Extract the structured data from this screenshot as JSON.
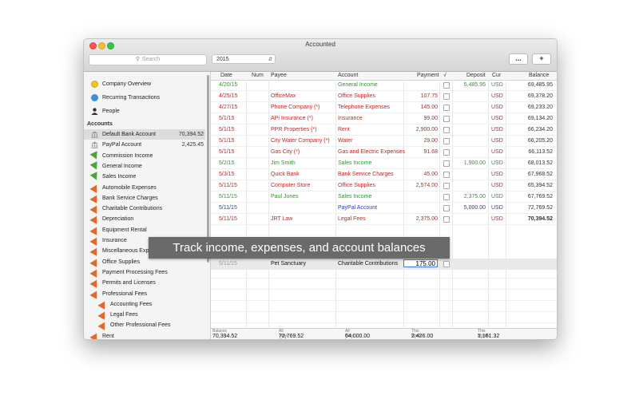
{
  "window": {
    "title": "Accounted"
  },
  "toolbar": {
    "search_placeholder": "Search",
    "year": "2015",
    "more_label": "...",
    "add_label": "+"
  },
  "sidebar": {
    "top_items": [
      {
        "label": "Company Overview",
        "icon": "company-overview-icon"
      },
      {
        "label": "Recurring Transactions",
        "icon": "recurring-icon"
      },
      {
        "label": "People",
        "icon": "person-icon"
      }
    ],
    "accounts_heading": "Accounts",
    "accounts": [
      {
        "label": "Default Bank Account",
        "amount": "70,394.52",
        "icon": "bank-icon"
      },
      {
        "label": "PayPal Account",
        "amount": "2,425.45",
        "icon": "bank-icon"
      },
      {
        "label": "Commission Income",
        "icon": "income-icon"
      },
      {
        "label": "General Income",
        "icon": "income-icon"
      },
      {
        "label": "Sales Income",
        "icon": "income-icon"
      },
      {
        "label": "Automobile Expenses",
        "icon": "expense-icon"
      },
      {
        "label": "Bank Service Charges",
        "icon": "expense-icon"
      },
      {
        "label": "Charitable Contributions",
        "icon": "expense-icon"
      },
      {
        "label": "Depreciation",
        "icon": "expense-icon"
      },
      {
        "label": "Equipment Rental",
        "icon": "expense-icon"
      },
      {
        "label": "Insurance",
        "icon": "expense-icon"
      },
      {
        "label": "Miscellaneous Expenses",
        "icon": "expense-icon"
      },
      {
        "label": "Office Supplies",
        "icon": "expense-icon"
      },
      {
        "label": "Payment Processing Fees",
        "icon": "expense-icon"
      },
      {
        "label": "Permits and Licenses",
        "icon": "expense-icon"
      },
      {
        "label": "Professional Fees",
        "icon": "expense-icon"
      },
      {
        "label": "Accounting Fees",
        "icon": "expense-icon"
      },
      {
        "label": "Legal Fees",
        "icon": "expense-icon"
      },
      {
        "label": "Other Professional Fees",
        "icon": "expense-icon"
      },
      {
        "label": "Rent",
        "icon": "expense-icon"
      }
    ]
  },
  "table": {
    "headers": [
      "Date",
      "Num",
      "Payee",
      "Account",
      "Payment",
      "√",
      "Deposit",
      "Cur",
      "Balance"
    ],
    "rows": [
      {
        "date": "4/20/15",
        "num": "",
        "payee": "",
        "account": "General Income",
        "payment": "",
        "deposit": "5,485.95",
        "cur": "USD",
        "balance": "69,485.95",
        "color": "#2a9a2a"
      },
      {
        "date": "4/25/15",
        "num": "",
        "payee": "OfficeMax",
        "account": "Office Supplies",
        "payment": "107.75",
        "deposit": "",
        "cur": "USD",
        "balance": "69,378.20",
        "color": "#cc2020"
      },
      {
        "date": "4/27/15",
        "num": "",
        "payee": "Phone Company (*)",
        "account": "Telephone Expenses",
        "payment": "145.00",
        "deposit": "",
        "cur": "USD",
        "balance": "69,233.20",
        "color": "#cc2020"
      },
      {
        "date": "5/1/15",
        "num": "",
        "payee": "APi Insurance (*)",
        "account": "Insurance",
        "payment": "99.00",
        "deposit": "",
        "cur": "USD",
        "balance": "69,134.20",
        "color": "#cc2020"
      },
      {
        "date": "5/1/15",
        "num": "",
        "payee": "PPR Properties (*)",
        "account": "Rent",
        "payment": "2,900.00",
        "deposit": "",
        "cur": "USD",
        "balance": "66,234.20",
        "color": "#cc2020"
      },
      {
        "date": "5/1/15",
        "num": "",
        "payee": "City Water Company (*)",
        "account": "Water",
        "payment": "29.00",
        "deposit": "",
        "cur": "USD",
        "balance": "66,205.20",
        "color": "#cc2020"
      },
      {
        "date": "5/1/15",
        "num": "",
        "payee": "Gas City (*)",
        "account": "Gas and Electric Expenses",
        "payment": "91.68",
        "deposit": "",
        "cur": "USD",
        "balance": "66,113.52",
        "color": "#cc2020"
      },
      {
        "date": "5/2/15",
        "num": "",
        "payee": "Jim Smith",
        "account": "Sales Income",
        "payment": "",
        "deposit": "1,900.00",
        "cur": "USD",
        "balance": "68,013.52",
        "color": "#2a9a2a"
      },
      {
        "date": "5/3/15",
        "num": "",
        "payee": "Quick Bank",
        "account": "Bank Service Charges",
        "payment": "45.00",
        "deposit": "",
        "cur": "USD",
        "balance": "67,968.52",
        "color": "#cc2020"
      },
      {
        "date": "5/11/15",
        "num": "",
        "payee": "Computer Store",
        "account": "Office Supplies",
        "payment": "2,574.00",
        "deposit": "",
        "cur": "USD",
        "balance": "65,394.52",
        "color": "#cc2020"
      },
      {
        "date": "5/11/15",
        "num": "",
        "payee": "Paul Jones",
        "account": "Sales Income",
        "payment": "",
        "deposit": "2,375.00",
        "cur": "USD",
        "balance": "67,769.52",
        "color": "#2a9a2a"
      },
      {
        "date": "5/11/15",
        "num": "",
        "payee": "",
        "account": "PayPal Account",
        "payment": "",
        "deposit": "5,000.00",
        "cur": "USD",
        "balance": "72,769.52",
        "color": "#1f3fbf"
      },
      {
        "date": "5/11/15",
        "num": "",
        "payee": "JRT Law",
        "account": "Legal Fees",
        "payment": "2,375.00",
        "deposit": "",
        "cur": "USD",
        "balance": "70,394.52",
        "color": "#cc2020"
      }
    ],
    "edit_row": {
      "date": "5/11/15",
      "payee": "Pet Sanctuary",
      "account": "Charitable Contributions",
      "payment": "175.00"
    }
  },
  "overlay_text": "Track income, expenses, and account balances",
  "footer": [
    {
      "label": "Balance",
      "value": "70,394.52"
    },
    {
      "label": "All Time High",
      "value": "72,769.52"
    },
    {
      "label": "All Time Low",
      "value": "64,000.00"
    },
    {
      "label": "This Week",
      "value": "2,426.00"
    },
    {
      "label": "This Month",
      "value": "1,161.32"
    }
  ]
}
